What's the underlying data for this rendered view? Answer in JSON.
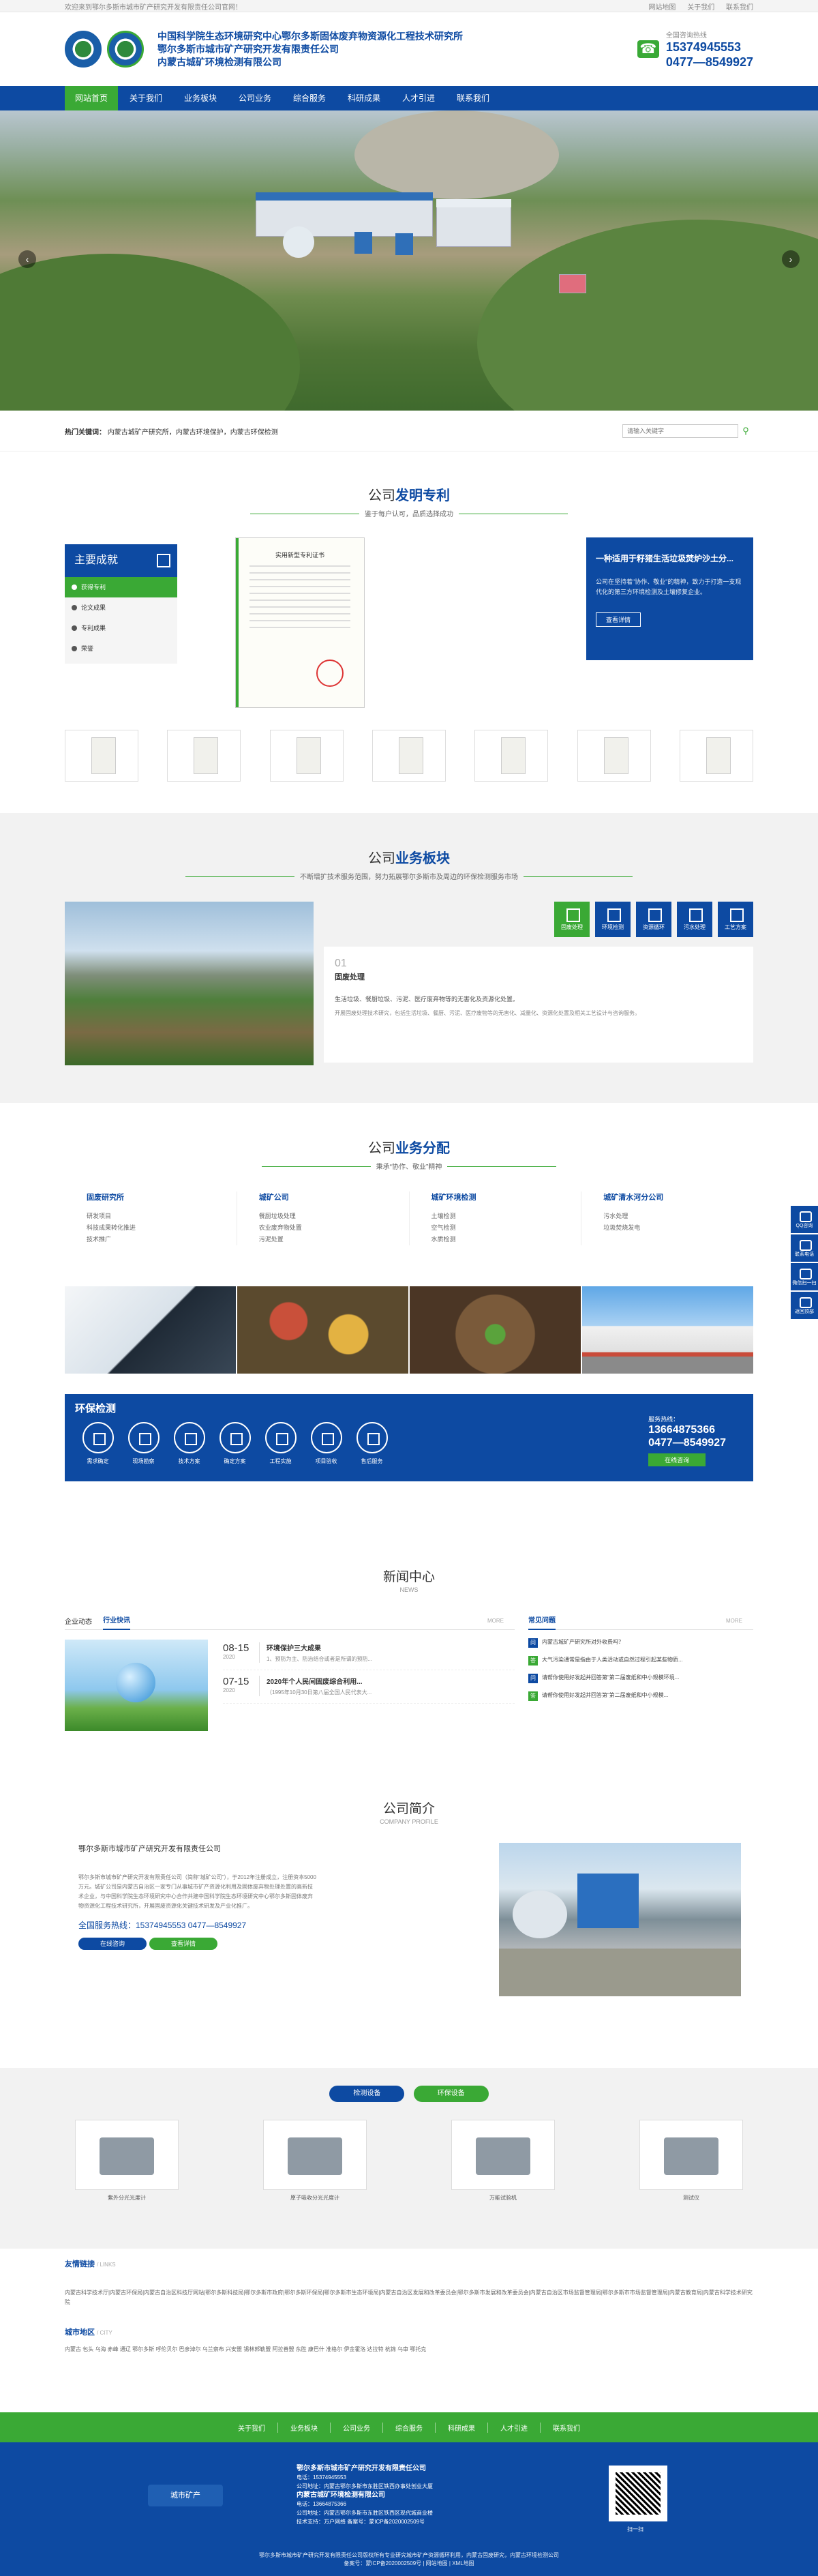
{
  "topbar": {
    "welcome": "欢迎来到鄂尔多斯市城市矿产研究开发有限责任公司官网！",
    "links": [
      "网站地图",
      "关于我们",
      "联系我们"
    ]
  },
  "header": {
    "titles": [
      "中国科学院生态环境研究中心鄂尔多斯固体废弃物资源化工程技术研究所",
      "鄂尔多斯市城市矿产研究开发有限责任公司",
      "内蒙古城矿环境检测有限公司"
    ],
    "hotline_label": "全国咨询热线",
    "hotline_1": "15374945553",
    "hotline_2": "0477—8549927"
  },
  "nav": [
    "网站首页",
    "关于我们",
    "业务板块",
    "公司业务",
    "综合服务",
    "科研成果",
    "人才引进",
    "联系我们"
  ],
  "search": {
    "keywords_label": "热门关键词：",
    "keywords": "内蒙古城矿产研究所，内蒙古环境保护，内蒙古环保检测",
    "placeholder": "请输入关键字"
  },
  "patents": {
    "title_a": "公司",
    "title_b": "发明专利",
    "subtitle": "鉴于每户认可，品质选择成功",
    "menu_title": "主要成就",
    "menu": [
      "获得专利",
      "论文成果",
      "专利成果",
      "荣誉"
    ],
    "cert_title": "实用新型专利证书",
    "card_title": "一种适用于籽猪生活垃圾焚炉沙土分...",
    "card_desc": "公司在坚持着\"协作、敬业\"的精神，致力于打造一支现代化的第三方环境检测及土壤修复企业。",
    "card_btn": "查看详情"
  },
  "business": {
    "title_a": "公司",
    "title_b": "业务板块",
    "subtitle": "不断增扩技术服务范围，努力拓展鄂尔多斯市及周边的环保检测服务市场",
    "icons": [
      "固废处理",
      "环境检测",
      "资源循环",
      "污水处理",
      "工艺方案"
    ],
    "num": "01",
    "name": "固废处理",
    "desc": "生活垃圾、餐厨垃圾、污泥、医疗废弃物等的无害化及资源化处置。",
    "desc2": "开展固废处理技术研究，包括生活垃圾、餐厨、污泥、医疗废物等的无害化、减量化、资源化处置及相关工艺设计与咨询服务。"
  },
  "distribution": {
    "title_a": "公司",
    "title_b": "业务分配",
    "subtitle": "秉承“协作、敬业”精神",
    "cols": [
      {
        "head": "固废研究所",
        "items": [
          "研发项目",
          "科技成果转化推进",
          "技术推广"
        ]
      },
      {
        "head": "城矿公司",
        "items": [
          "餐厨垃圾处理",
          "农业废弃物处置",
          "污泥处置"
        ]
      },
      {
        "head": "城矿环境检测",
        "items": [
          "土壤检测",
          "空气检测",
          "水质检测"
        ]
      },
      {
        "head": "城矿清水河分公司",
        "items": [
          "污水处理",
          "垃圾焚烧发电"
        ]
      }
    ],
    "env_title": "环保检测",
    "env_icons": [
      "需求确定",
      "现场勘察",
      "技术方案",
      "确定方案",
      "工程实施",
      "项目验收",
      "售后服务"
    ],
    "env_hot_label": "服务热线：",
    "env_hot_1": "13664875366",
    "env_hot_2": "0477—8549927",
    "env_btn": "在线咨询"
  },
  "news": {
    "title": "新闻中心",
    "en": "NEWS",
    "tabs": [
      "企业动态",
      "行业快讯"
    ],
    "more": "MORE",
    "items": [
      {
        "day": "08-15",
        "year": "2020",
        "title": "环境保护三大成果",
        "desc": "1、预防为主、防治结合或者是所谓的预防..."
      },
      {
        "day": "07-15",
        "year": "2020",
        "title": "2020年个人民间固废综合利用...",
        "desc": "（1995年10月30日第八届全国人民代表大..."
      }
    ],
    "faq_title": "常见问题",
    "faq_more": "MORE",
    "faq": [
      {
        "q": "问",
        "text": "内蒙古城矿产研究所对外收费吗？"
      },
      {
        "q": "答",
        "text": "大气污染通常是指由于人类活动或自然过程引起某些物质..."
      },
      {
        "q": "问",
        "text": "请帮你使用好发起并回答第“第二届废纸和中小规模环境..."
      },
      {
        "q": "答",
        "text": "请帮你使用好发起并回答第“第二届废纸和中小规模..."
      }
    ]
  },
  "profile": {
    "title": "公司简介",
    "en": "COMPANY PROFILE",
    "name": "鄂尔多斯市城市矿产研究开发有限责任公司",
    "desc": "鄂尔多斯市城市矿产研究开发有限责任公司（简称“城矿公司”），于2012年注册成立，注册资本5000万元。城矿公司是内蒙古自治区一家专门从事城市矿产资源化利用及固体废弃物处理处置的高新技术企业，与中国科学院生态环境研究中心合作共建中国科学院生态环境研究中心鄂尔多斯固体废弃物资源化工程技术研究所，开展固废资源化关键技术研发及产业化推广。",
    "tel": "全国服务热线：15374945553 0477—8549927",
    "btn1": "在线咨询",
    "btn2": "查看详情"
  },
  "equipment": {
    "tabs": [
      "检测设备",
      "环保设备"
    ],
    "items": [
      "紫外分光光度计",
      "原子吸收分光光度计",
      "万能试验机",
      "测试仪"
    ]
  },
  "friendlinks": {
    "title": "友情链接",
    "en": "/ LINKS",
    "text": "内蒙古科学技术厅|内蒙古环保局|内蒙古自治区科技厅网站|鄂尔多斯科技局|鄂尔多斯市政府|鄂尔多斯环保局|鄂尔多斯市生态环境局|内蒙古自治区发展和改革委员会|鄂尔多斯市发展和改革委员会|内蒙古自治区市场监督管理局|鄂尔多斯市市场监督管理局|内蒙古教育局|内蒙古科学技术研究院",
    "area_title": "城市地区",
    "area_en": "/ CITY",
    "areas": "内蒙古 包头 乌海 赤峰 通辽 鄂尔多斯 呼伦贝尔 巴彦淖尔 乌兰察布 兴安盟 锡林郭勒盟 阿拉善盟 东胜 康巴什 准格尔 伊金霍洛 达拉特 杭锦 乌审 鄂托克"
  },
  "bottom_nav": [
    "关于我们",
    "业务板块",
    "公司业务",
    "综合服务",
    "科研成果",
    "人才引进",
    "联系我们"
  ],
  "footer": {
    "logo": "城市矿产",
    "company1": "鄂尔多斯市城市矿产研究开发有限责任公司",
    "tel1": "电话：15374945553",
    "addr1": "公司地址：内蒙古鄂尔多斯市东胜区铁西办事处创业大厦",
    "company2": "内蒙古城矿环境检测有限公司",
    "tel2": "电话：13664875366",
    "addr2": "公司地址：内蒙古鄂尔多斯市东胜区铁西区现代城商业楼",
    "tech": "技术支持：万户网络  备案号：蒙ICP备2020002509号",
    "qr_label": "扫一扫",
    "copy1": "鄂尔多斯市城市矿产研究开发有限责任公司版权所有专业研究城市矿产资源循环利用，内蒙古固废研究，内蒙古环境检测公司",
    "copy2": "备案号：蒙ICP备2020002509号 | 网站地图 | XML地图"
  },
  "floatbar": [
    "QQ咨询",
    "联系电话",
    "微信扫一扫",
    "返回顶部"
  ]
}
